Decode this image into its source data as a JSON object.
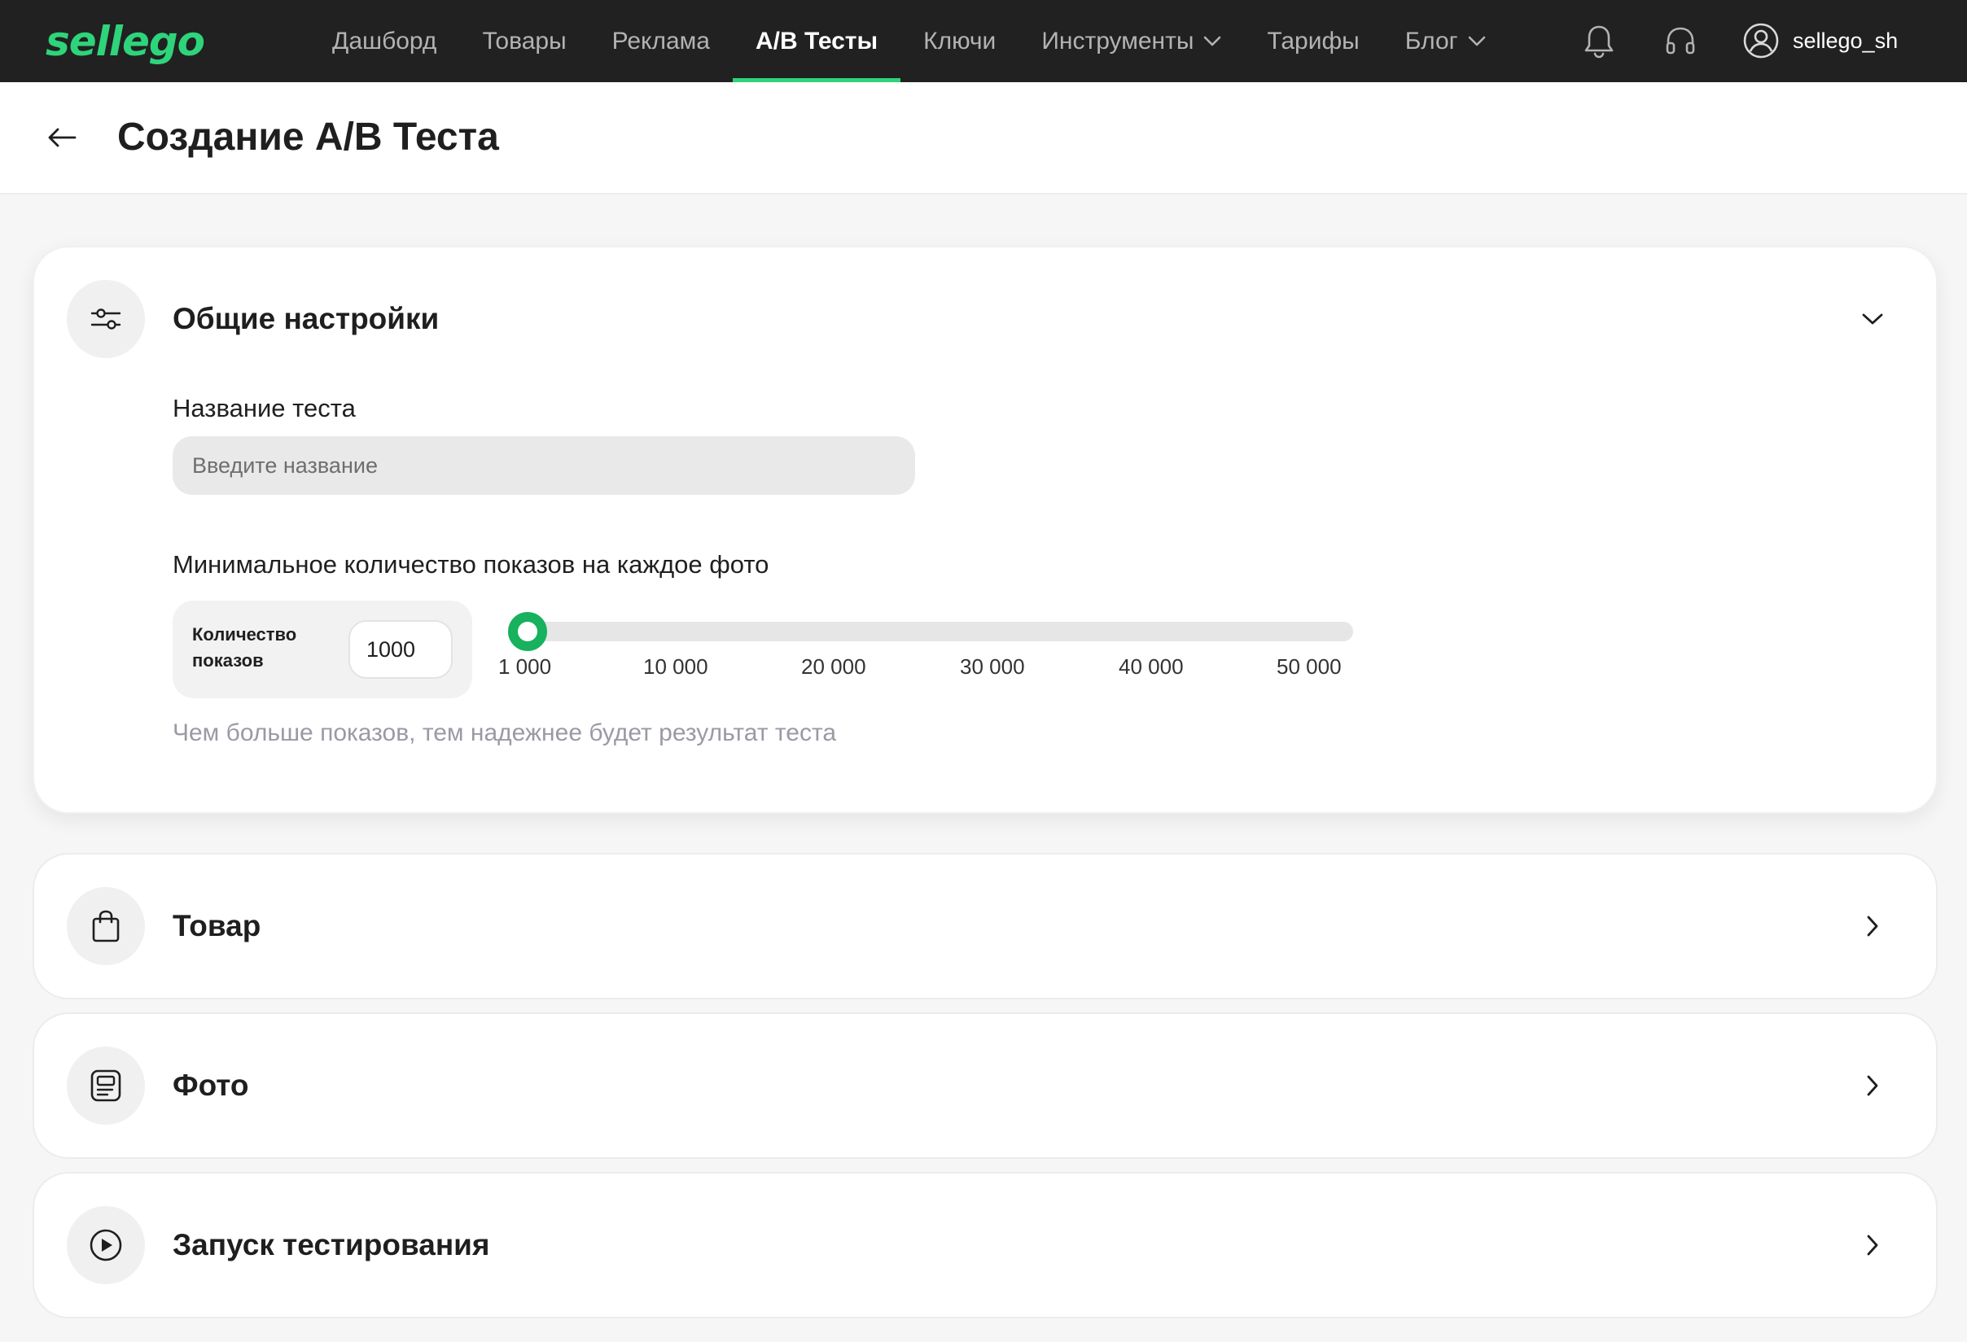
{
  "brand": {
    "logo_text": "sellego",
    "accent_color": "#2ed47a",
    "slider_color": "#18b15e"
  },
  "nav": {
    "items": [
      {
        "label": "Дашборд",
        "active": false,
        "dropdown": false
      },
      {
        "label": "Товары",
        "active": false,
        "dropdown": false
      },
      {
        "label": "Реклама",
        "active": false,
        "dropdown": false
      },
      {
        "label": "A/B Тесты",
        "active": true,
        "dropdown": false
      },
      {
        "label": "Ключи",
        "active": false,
        "dropdown": false
      },
      {
        "label": "Инструменты",
        "active": false,
        "dropdown": true
      },
      {
        "label": "Тарифы",
        "active": false,
        "dropdown": false
      },
      {
        "label": "Блог",
        "active": false,
        "dropdown": true
      }
    ],
    "icons": [
      "bell-icon",
      "headset-icon"
    ],
    "user": {
      "name": "sellego_sh",
      "icon": "user-circle-icon"
    }
  },
  "header": {
    "back_icon": "arrow-left-icon",
    "title": "Создание A/B Теста"
  },
  "general": {
    "title": "Общие настройки",
    "icon": "sliders-icon",
    "expanded": true,
    "name_label": "Название теста",
    "name_placeholder": "Введите название",
    "name_value": "",
    "impressions_label": "Минимальное количество показов на каждое фото",
    "count_label": "Количество показов",
    "count_value": "1000",
    "slider": {
      "min": 1000,
      "max": 50000,
      "value": 1000,
      "ticks": [
        "1 000",
        "10 000",
        "20 000",
        "30 000",
        "40 000",
        "50 000"
      ]
    },
    "hint": "Чем больше показов, тем надежнее будет результат теста"
  },
  "sections": [
    {
      "title": "Товар",
      "icon": "shopping-bag-icon"
    },
    {
      "title": "Фото",
      "icon": "photo-card-icon"
    },
    {
      "title": "Запуск тестирования",
      "icon": "play-circle-icon"
    }
  ]
}
